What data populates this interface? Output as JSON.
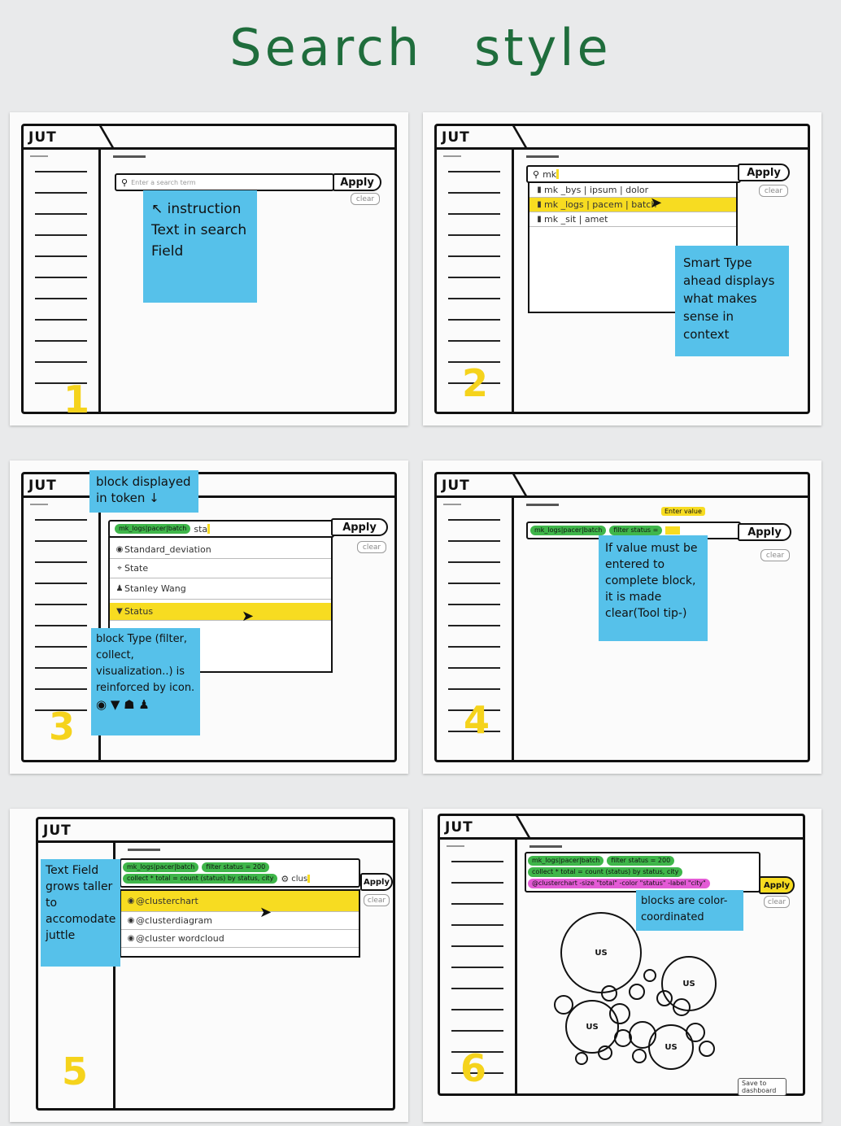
{
  "title": "Search style",
  "logo": "JUT",
  "apply_label": "Apply",
  "clear_label": "clear",
  "panels": [
    {
      "number": "1",
      "search_placeholder": "Enter a search term",
      "sticky": "↖ instruction Text in search Field"
    },
    {
      "number": "2",
      "search_value": "mk",
      "suggestions": [
        {
          "text": "mk _bys | ipsum | dolor"
        },
        {
          "text": "mk _logs | pacem | batch"
        },
        {
          "text": "mk _sit | amet"
        }
      ],
      "sticky": "Smart Type ahead displays what makes sense in context"
    },
    {
      "number": "3",
      "sticky_top": "block displayed in token ↓",
      "token": "mk_logs|pacer|batch",
      "search_value": "sta",
      "suggestions": [
        {
          "text": "Standard_deviation",
          "icon": "eye-icon",
          "glyph": "◉"
        },
        {
          "text": "State",
          "icon": "filter-icon",
          "glyph": "⌖"
        },
        {
          "text": "Stanley Wang",
          "icon": "user-icon",
          "glyph": "♟"
        },
        {
          "text": "Status",
          "icon": "funnel-icon",
          "glyph": "▼"
        }
      ],
      "sticky": "block Type (filter, collect, visualization..) is reinforced by icon.",
      "sticky_icons": "◉ ▼ ☗ ♟"
    },
    {
      "number": "4",
      "token1": "mk_logs|pacer|batch",
      "token2": "filter status =",
      "tooltip": "Enter value",
      "sticky": "If value must be entered to complete block, it is made clear(Tool tip-)"
    },
    {
      "number": "5",
      "line1_token1": "mk_logs|pacer|batch",
      "line1_token2": "filter status = 200",
      "line2_token": "collect * total = count (status) by status, city",
      "search_value": "clus",
      "suggestions": [
        {
          "text": "@clusterchart"
        },
        {
          "text": "@clusterdiagram"
        },
        {
          "text": "@cluster wordcloud"
        }
      ],
      "sticky": "Text Field grows taller to accomodate juttle"
    },
    {
      "number": "6",
      "line1_token1": "mk_logs|pacer|batch",
      "line1_token2": "filter status = 200",
      "line2_token": "collect * total = count (status) by status, city",
      "line3_token": "@clusterchart -size \"total\" -color \"status\" -label \"city\"",
      "sticky": "blocks are color-coordinated",
      "bubble_label": "US",
      "save_label": "Save to dashboard"
    }
  ]
}
